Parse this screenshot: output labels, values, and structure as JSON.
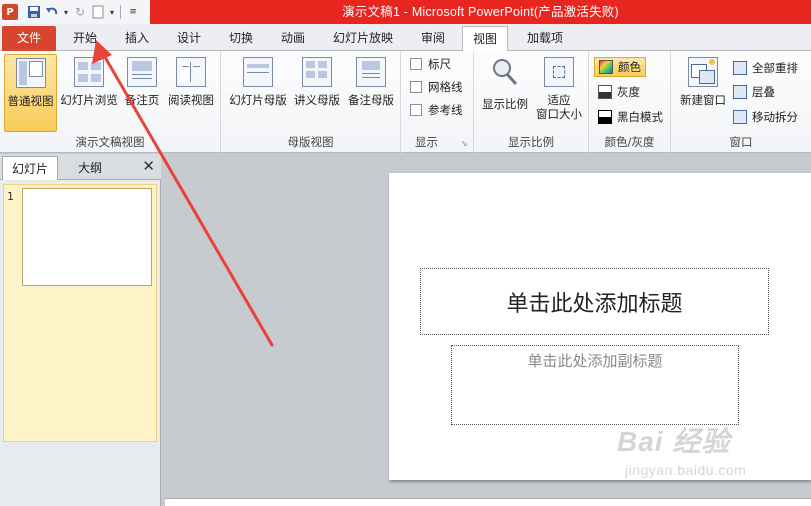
{
  "window": {
    "title": "演示文稿1 - Microsoft PowerPoint(产品激活失败)",
    "app_icon_letter": "P",
    "quick_access": [
      "save-icon",
      "undo-icon",
      "redo-icon",
      "customize-icon"
    ]
  },
  "tabs": [
    "文件",
    "开始",
    "插入",
    "设计",
    "切换",
    "动画",
    "幻灯片放映",
    "审阅",
    "视图",
    "加载项"
  ],
  "active_tab": "视图",
  "ribbon": {
    "presentation_views": {
      "label": "演示文稿视图",
      "buttons": [
        "普通视图",
        "幻灯片浏览",
        "备注页",
        "阅读视图"
      ]
    },
    "master_views": {
      "label": "母版视图",
      "buttons": [
        "幻灯片母版",
        "讲义母版",
        "备注母版"
      ]
    },
    "show": {
      "label": "显示",
      "checkboxes": [
        "标尺",
        "网格线",
        "参考线"
      ]
    },
    "zoom": {
      "label": "显示比例",
      "buttons": [
        "显示比例",
        "适应",
        "窗口大小"
      ]
    },
    "color": {
      "label": "颜色/灰度",
      "options": [
        "颜色",
        "灰度",
        "黑白模式"
      ]
    },
    "window": {
      "label": "窗口",
      "new_window": "新建窗口",
      "options": [
        "全部重排",
        "层叠",
        "移动拆分"
      ]
    }
  },
  "left_pane": {
    "tabs": [
      "幻灯片",
      "大纲"
    ],
    "close": "✕",
    "slide_number": "1"
  },
  "slide": {
    "title_placeholder": "单击此处添加标题",
    "subtitle_placeholder": "单击此处添加副标题"
  },
  "watermark": {
    "main": "Bai 经验",
    "sub": "jingyan.baidu.com"
  },
  "colors": {
    "title_bar": "#e8261f",
    "file_tab": "#d8452f",
    "annotation_arrow": "#e8433a"
  }
}
